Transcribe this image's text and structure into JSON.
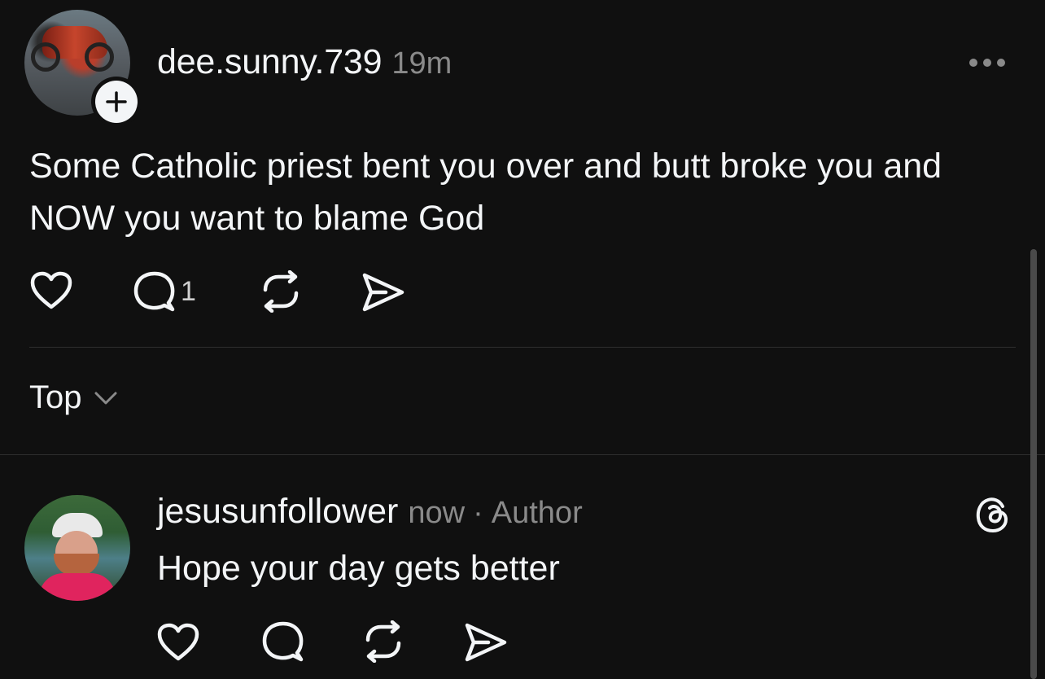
{
  "post": {
    "username": "dee.sunny.739",
    "time": "19m",
    "text": "Some Catholic priest bent you over and butt broke you and NOW you want to blame God",
    "reply_count": "1",
    "icons": {
      "avatar": "motorcycle-avatar",
      "follow": "plus-icon",
      "more": "more-icon",
      "like": "heart-icon",
      "comment": "comment-icon",
      "repost": "repost-icon",
      "share": "send-icon"
    }
  },
  "sort": {
    "label": "Top",
    "icon": "chevron-down-icon"
  },
  "reply": {
    "username": "jesusunfollower",
    "time": "now",
    "separator": "·",
    "badge": "Author",
    "text": "Hope your day gets better",
    "icons": {
      "avatar": "profile-photo-avatar",
      "app": "threads-icon",
      "like": "heart-icon",
      "comment": "comment-icon",
      "repost": "repost-icon",
      "share": "send-icon"
    }
  },
  "colors": {
    "background": "#101010",
    "text": "#f3f5f7",
    "muted": "#8a8a8a",
    "divider": "#2e2e2e"
  }
}
